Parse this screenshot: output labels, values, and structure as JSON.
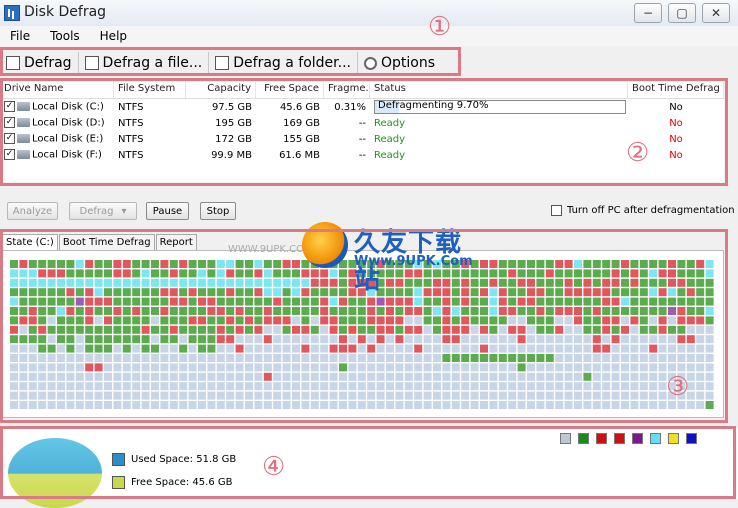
{
  "window": {
    "title": "Disk Defrag",
    "minimize": "−",
    "maximize": "▢",
    "close": "✕"
  },
  "menu": [
    "File",
    "Tools",
    "Help"
  ],
  "toolbar": [
    {
      "label": "Defrag",
      "icon": "defrag-icon"
    },
    {
      "label": "Defrag a file...",
      "icon": "file-icon"
    },
    {
      "label": "Defrag a folder...",
      "icon": "folder-icon"
    },
    {
      "label": "Options",
      "icon": "gear-icon"
    }
  ],
  "annotations": [
    "①",
    "②",
    "③",
    "④"
  ],
  "drives": {
    "columns": [
      "Drive Name",
      "File System",
      "Capacity",
      "Free Space",
      "Fragme...",
      "Status",
      "Boot Time Defrag"
    ],
    "rows": [
      {
        "name": "Local Disk (C:)",
        "fs": "NTFS",
        "capacity": "97.5 GB",
        "free": "45.6 GB",
        "frag": "0.31%",
        "status": "Defragmenting 9.70%",
        "progress": 0.097,
        "boot": "No",
        "status_kind": "progress",
        "boot_color": "black"
      },
      {
        "name": "Local Disk (D:)",
        "fs": "NTFS",
        "capacity": "195 GB",
        "free": "169 GB",
        "frag": "--",
        "status": "Ready",
        "boot": "No",
        "status_kind": "ready",
        "boot_color": "red"
      },
      {
        "name": "Local Disk (E:)",
        "fs": "NTFS",
        "capacity": "172 GB",
        "free": "155 GB",
        "frag": "--",
        "status": "Ready",
        "boot": "No",
        "status_kind": "ready",
        "boot_color": "red"
      },
      {
        "name": "Local Disk (F:)",
        "fs": "NTFS",
        "capacity": "99.9 MB",
        "free": "61.6 MB",
        "frag": "--",
        "status": "Ready",
        "boot": "No",
        "status_kind": "ready",
        "boot_color": "red"
      }
    ]
  },
  "actions": {
    "analyze": "Analyze",
    "defrag": "Defrag",
    "pause": "Pause",
    "stop": "Stop",
    "turnoff": "Turn off PC after defragmentation"
  },
  "tabs": [
    "State (C:)",
    "Boot Time Defrag",
    "Report"
  ],
  "watermark": {
    "big": "久友下载站",
    "url": "Www.9UPK.Com",
    "small": "WWW.9UPK.COM"
  },
  "cluster_colors": {
    "free": "#c7d5e6",
    "used": "#5cab4e",
    "fragmented": "#e0585e",
    "mft": "#7ee6f0",
    "purple": "#a05ab0",
    "yellow": "#f0e030",
    "blue": "#2030c0",
    "gray": "#c0c0c0"
  },
  "legend_squares": [
    "#c0c8d8",
    "#1a8a1a",
    "#d01010",
    "#d01010",
    "#7a1a8a",
    "#60e0f0",
    "#f0e020",
    "#1010c0"
  ],
  "space": {
    "used_label": "Used Space: 51.8 GB",
    "free_label": "Free Space: 45.6 GB",
    "used_color": "#2a8fc8",
    "free_color": "#c8d84c"
  }
}
